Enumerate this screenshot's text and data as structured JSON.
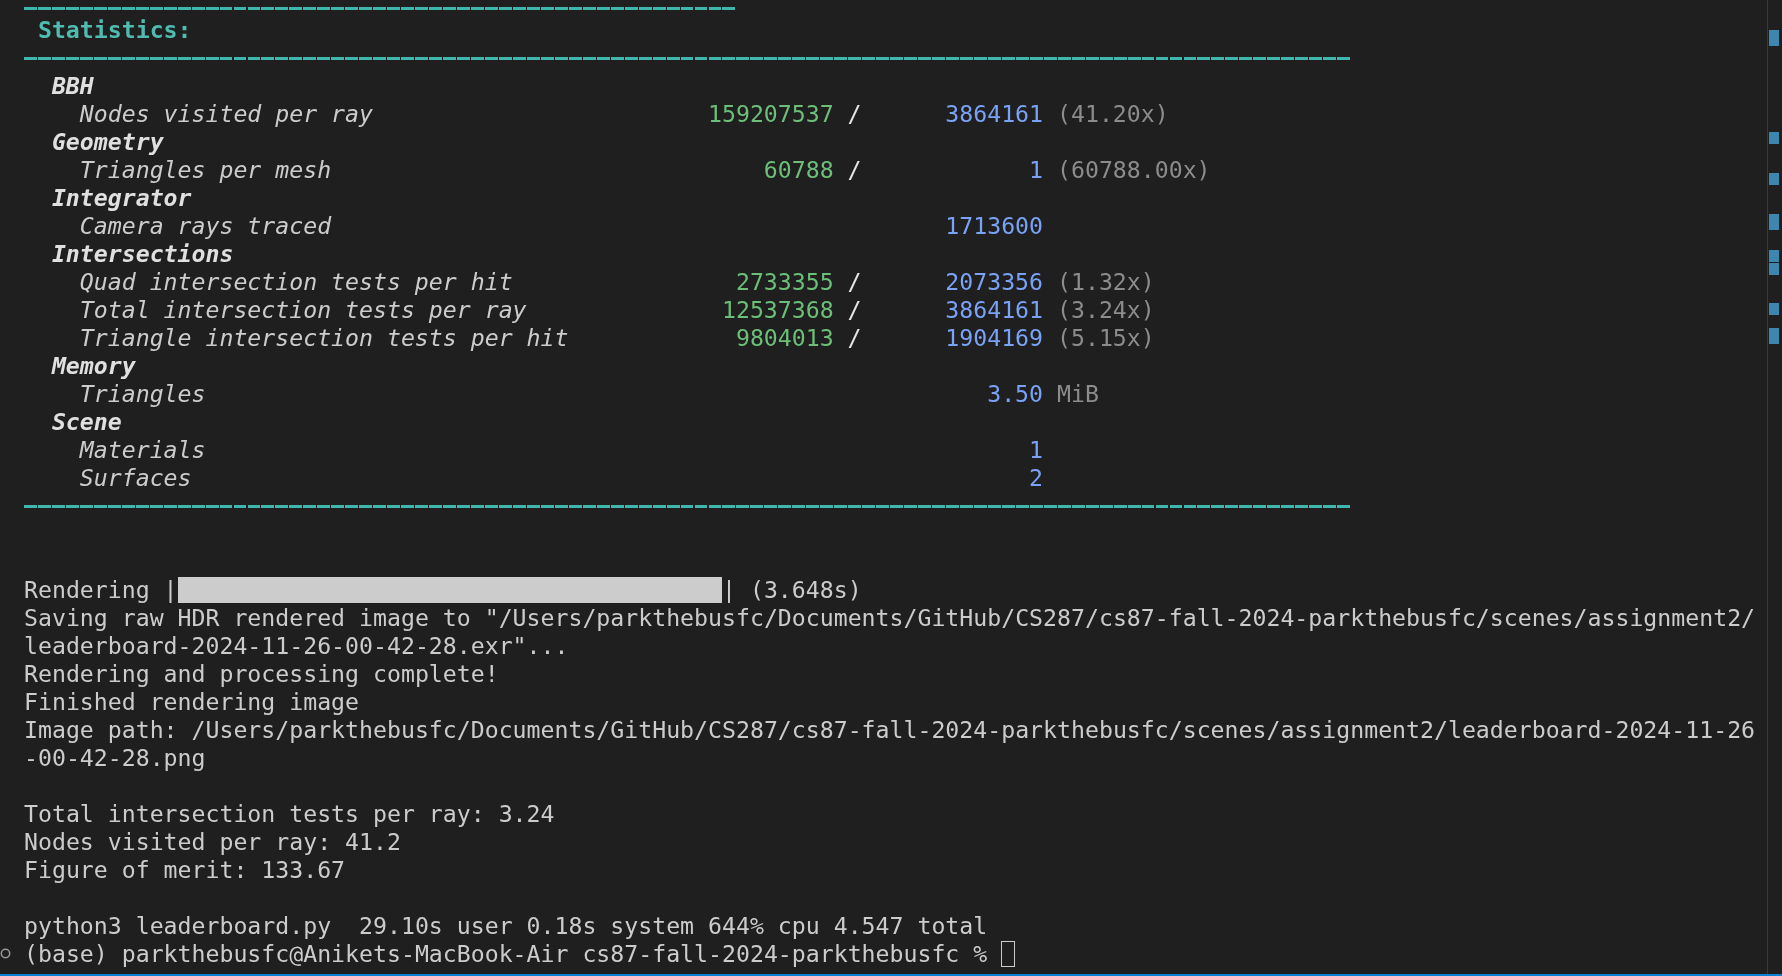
{
  "statistics": {
    "title": "Statistics:",
    "categories": [
      {
        "name": "BBH",
        "stats": [
          {
            "kind": "ratio",
            "label": "Nodes visited per ray",
            "numerator": "159207537",
            "separator": "/",
            "denominator": "3864161",
            "ratio": "(41.20x)"
          }
        ]
      },
      {
        "name": "Geometry",
        "stats": [
          {
            "kind": "ratio",
            "label": "Triangles per mesh",
            "numerator": "60788",
            "separator": "/",
            "denominator": "1",
            "ratio": "(60788.00x)"
          }
        ]
      },
      {
        "name": "Integrator",
        "stats": [
          {
            "kind": "count",
            "label": "Camera rays traced",
            "value": "1713600"
          }
        ]
      },
      {
        "name": "Intersections",
        "stats": [
          {
            "kind": "ratio",
            "label": "Quad intersection tests per hit",
            "numerator": "2733355",
            "separator": "/",
            "denominator": "2073356",
            "ratio": "(1.32x)"
          },
          {
            "kind": "ratio",
            "label": "Total intersection tests per ray",
            "numerator": "12537368",
            "separator": "/",
            "denominator": "3864161",
            "ratio": "(3.24x)"
          },
          {
            "kind": "ratio",
            "label": "Triangle intersection tests per hit",
            "numerator": "9804013",
            "separator": "/",
            "denominator": "1904169",
            "ratio": "(5.15x)"
          }
        ]
      },
      {
        "name": "Memory",
        "stats": [
          {
            "kind": "memory",
            "label": "Triangles",
            "value": "3.50",
            "unit": "MiB"
          }
        ]
      },
      {
        "name": "Scene",
        "stats": [
          {
            "kind": "count",
            "label": "Materials",
            "value": "1"
          },
          {
            "kind": "count",
            "label": "Surfaces",
            "value": "2"
          }
        ]
      }
    ]
  },
  "progress": {
    "label": "Rendering",
    "open": "|",
    "level": 1,
    "close": "|",
    "elapsed": "(3.648s)"
  },
  "output_blocks": [
    [
      "Saving raw HDR rendered image to \"/Users/parkthebusfc/Documents/GitHub/CS287/cs87-fall-2024-parkthebusfc/scenes/assignment2/leaderboard-2024-11-26-00-42-28.exr\"...",
      "Rendering and processing complete!",
      "Finished rendering image",
      "Image path: /Users/parkthebusfc/Documents/GitHub/CS287/cs87-fall-2024-parkthebusfc/scenes/assignment2/leaderboard-2024-11-26-00-42-28.png"
    ],
    [
      "Total intersection tests per ray: 3.24",
      "Nodes visited per ray: 41.2",
      "Figure of merit: 133.67"
    ],
    [
      "python3 leaderboard.py  29.10s user 0.18s system 644% cpu 4.547 total"
    ]
  ],
  "prompt": {
    "text": "(base) parkthebusfc@Anikets-MacBook-Air cs87-fall-2024-parkthebusfc %"
  }
}
